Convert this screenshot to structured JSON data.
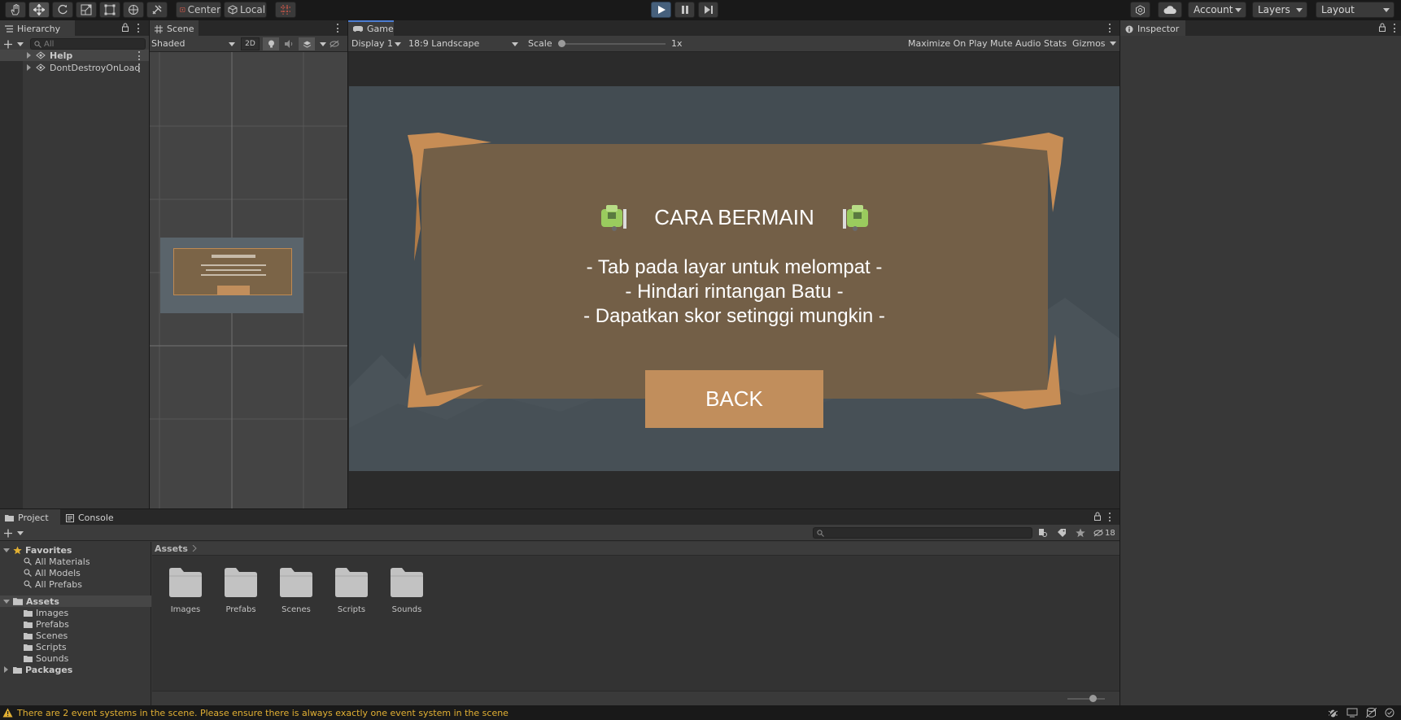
{
  "toolbar": {
    "pivot_center": "Center",
    "pivot_local": "Local",
    "account": "Account",
    "layers": "Layers",
    "layout": "Layout"
  },
  "hierarchy": {
    "tab": "Hierarchy",
    "search_placeholder": "All",
    "items": [
      {
        "label": "Help"
      },
      {
        "label": "DontDestroyOnLoad"
      }
    ]
  },
  "scene": {
    "tab": "Scene",
    "draw_mode": "Shaded",
    "mode_2d": "2D"
  },
  "game": {
    "tab": "Game",
    "display": "Display 1",
    "aspect": "18:9 Landscape",
    "scale_label": "Scale",
    "scale_value": "1x",
    "maximize": "Maximize On Play",
    "mute": "Mute Audio",
    "stats": "Stats",
    "gizmos": "Gizmos",
    "title": "CARA BERMAIN",
    "lines": [
      "- Tab pada layar untuk melompat -",
      "- Hindari rintangan Batu -",
      "- Dapatkan skor setinggi mungkin -"
    ],
    "back": "BACK"
  },
  "inspector": {
    "tab": "Inspector"
  },
  "project": {
    "tab": "Project",
    "console_tab": "Console",
    "hidden_count": "18",
    "breadcrumb": "Assets",
    "favorites": {
      "label": "Favorites",
      "items": [
        "All Materials",
        "All Models",
        "All Prefabs"
      ]
    },
    "assets": {
      "label": "Assets",
      "items": [
        "Images",
        "Prefabs",
        "Scenes",
        "Scripts",
        "Sounds"
      ]
    },
    "packages": "Packages",
    "grid": [
      "Images",
      "Prefabs",
      "Scenes",
      "Scripts",
      "Sounds"
    ]
  },
  "status": {
    "message": "There are 2 event systems in the scene. Please ensure there is always exactly one event system in the scene",
    "warning_color": "#e2b033"
  },
  "colors": {
    "accent": "#4c7dd3",
    "game_bg": "#434c52",
    "panel_board": "#735f47",
    "back_button": "#c18e5c"
  }
}
